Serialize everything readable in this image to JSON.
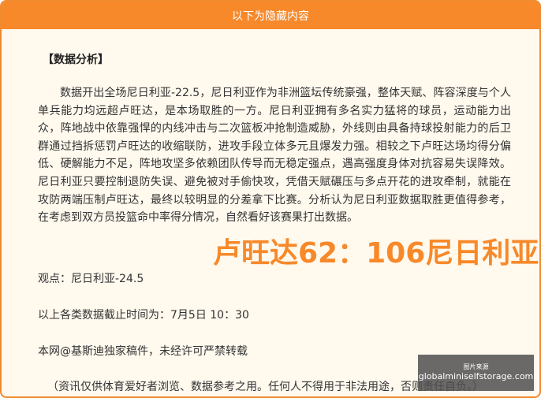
{
  "header": {
    "title": "以下为隐藏内容"
  },
  "article": {
    "section_title": "【数据分析】",
    "paragraph": "数据开出全场尼日利亚-22.5，尼日利亚作为非洲篮坛传统豪强，整体天赋、阵容深度与个人单兵能力均远超卢旺达，是本场取胜的一方。尼日利亚拥有多名实力猛将的球员，运动能力出众，阵地战中依靠强悍的内线冲击与二次篮板冲抢制造威胁，外线则由具备持球投射能力的后卫群通过挡拆惩罚卢旺达的收缩联防，进攻手段立体多元且爆发力强。相较之下卢旺达场均得分偏低、硬解能力不足，阵地攻坚多依赖团队传导而无稳定强点，遇高强度身体对抗容易失误降效。尼日利亚只要控制退防失误、避免被对手偷快攻，凭借天赋碾压与多点开花的进攻牵制，就能在攻防两端压制卢旺达，最终以较明显的分差拿下比赛。分析认为尼日利亚数据取胜更值得参考，在考虑到双方员投篮命中率得分情况，自然看好该赛果打出数据。",
    "viewpoint": "观点：尼日利亚-24.5",
    "data_time": "以上各类数据截止时间为：7月5日 10：30",
    "copyright": "本网@基斯迪独家稿件，未经许可严禁转载",
    "disclaimer": "（资讯仅供体育爱好者浏览、数据参考之用。任何人不得用于非法用途，否则责任自负。）"
  },
  "overlay": {
    "score": "卢旺达62：106尼日利亚"
  },
  "badge": {
    "top": "图片来源",
    "domain": "globalminiselfstorage.com"
  }
}
